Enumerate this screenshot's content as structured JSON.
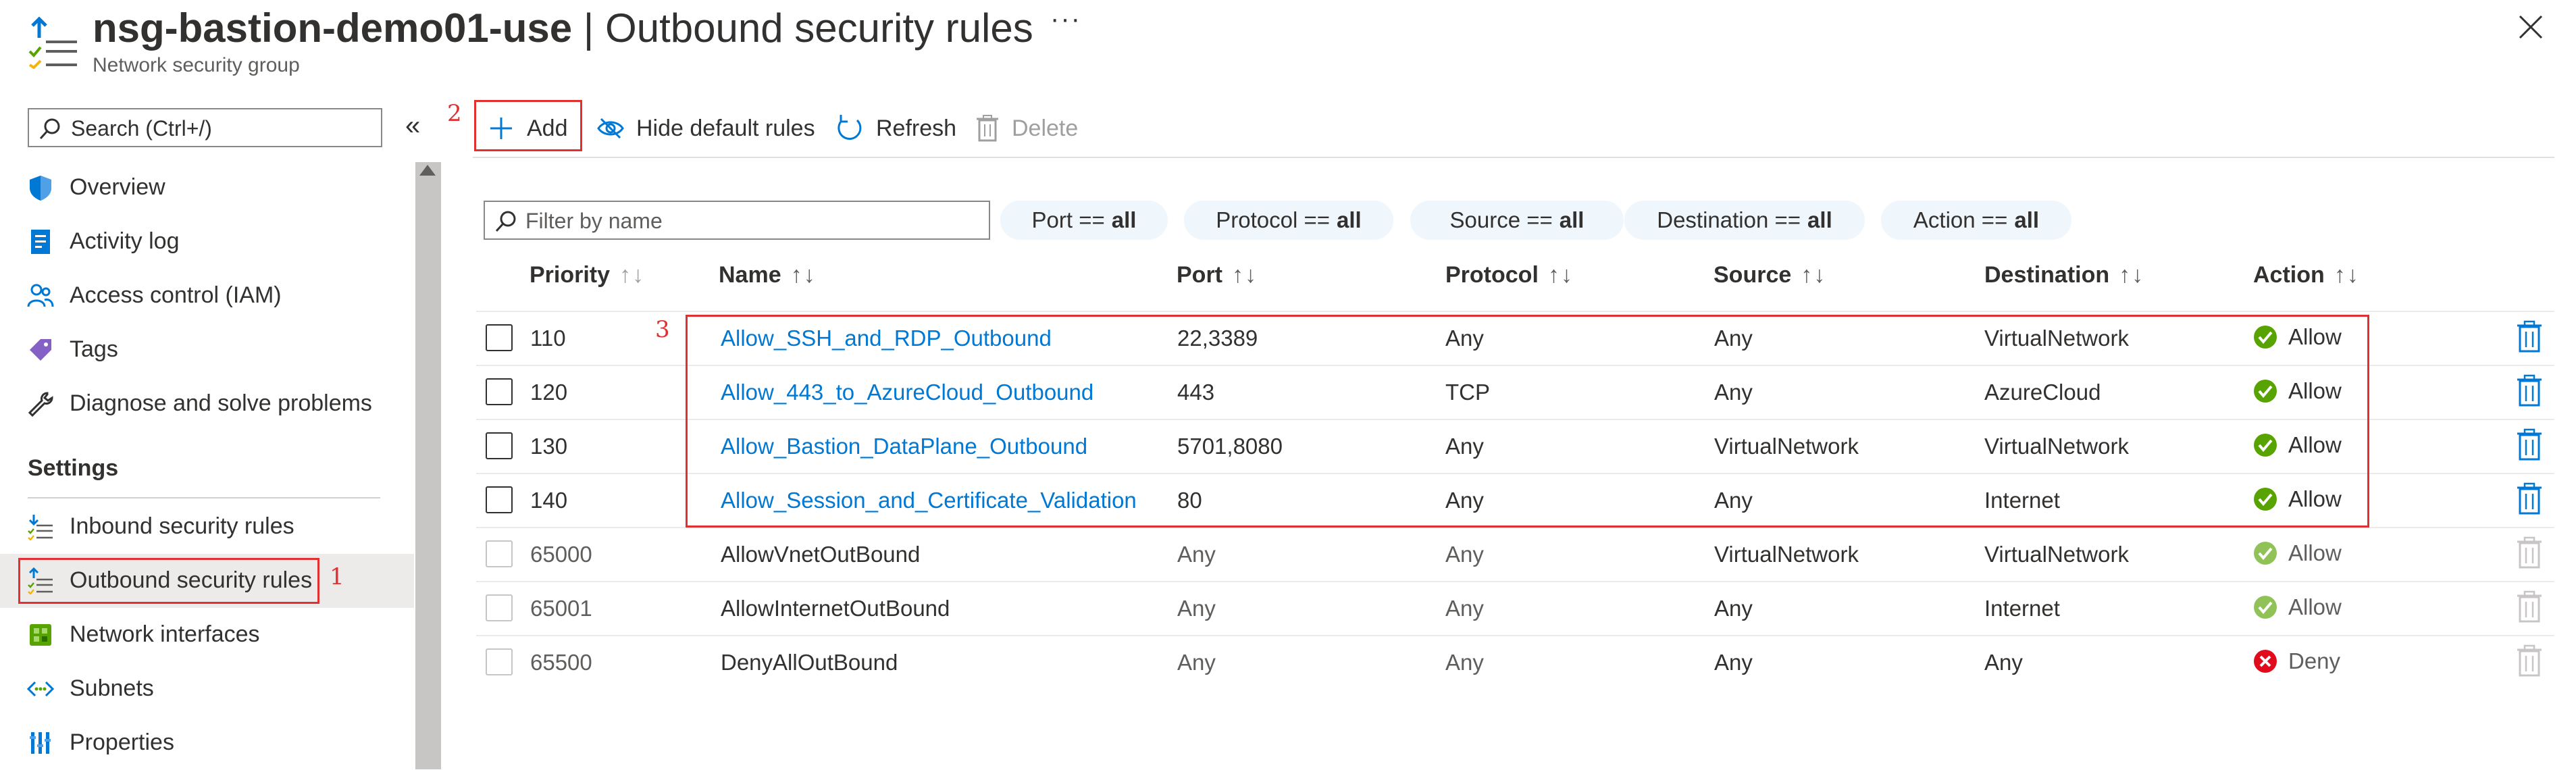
{
  "header": {
    "title_resource": "nsg-bastion-demo01-use",
    "title_separator": " | ",
    "title_page": "Outbound security rules",
    "subtitle": "Network security group",
    "more_label": "···"
  },
  "sidebar": {
    "search_placeholder": "Search (Ctrl+/)",
    "collapse_label": "«",
    "items": [
      {
        "label": "Overview",
        "icon": "shield-icon"
      },
      {
        "label": "Activity log",
        "icon": "activity-log-icon"
      },
      {
        "label": "Access control (IAM)",
        "icon": "people-icon"
      },
      {
        "label": "Tags",
        "icon": "tag-icon"
      },
      {
        "label": "Diagnose and solve problems",
        "icon": "wrench-icon"
      }
    ],
    "settings_header": "Settings",
    "settings_items": [
      {
        "label": "Inbound security rules",
        "icon": "inbound-rules-icon"
      },
      {
        "label": "Outbound security rules",
        "icon": "outbound-rules-icon",
        "selected": true
      },
      {
        "label": "Network interfaces",
        "icon": "network-interface-icon"
      },
      {
        "label": "Subnets",
        "icon": "subnet-icon"
      },
      {
        "label": "Properties",
        "icon": "properties-icon"
      }
    ]
  },
  "toolbar": {
    "add_label": "Add",
    "hide_default_label": "Hide default rules",
    "refresh_label": "Refresh",
    "delete_label": "Delete"
  },
  "filters": {
    "name_placeholder": "Filter by name",
    "pills": [
      {
        "key": "Port == ",
        "value": "all"
      },
      {
        "key": "Protocol == ",
        "value": "all"
      },
      {
        "key": "Source == ",
        "value": "all"
      },
      {
        "key": "Destination == ",
        "value": "all"
      },
      {
        "key": "Action == ",
        "value": "all"
      }
    ]
  },
  "table": {
    "columns": [
      "Priority",
      "Name",
      "Port",
      "Protocol",
      "Source",
      "Destination",
      "Action"
    ],
    "rows": [
      {
        "priority": "110",
        "name": "Allow_SSH_and_RDP_Outbound",
        "port": "22,3389",
        "protocol": "Any",
        "source": "Any",
        "destination": "VirtualNetwork",
        "action": "Allow",
        "custom": true
      },
      {
        "priority": "120",
        "name": "Allow_443_to_AzureCloud_Outbound",
        "port": "443",
        "protocol": "TCP",
        "source": "Any",
        "destination": "AzureCloud",
        "action": "Allow",
        "custom": true
      },
      {
        "priority": "130",
        "name": "Allow_Bastion_DataPlane_Outbound",
        "port": "5701,8080",
        "protocol": "Any",
        "source": "VirtualNetwork",
        "destination": "VirtualNetwork",
        "action": "Allow",
        "custom": true
      },
      {
        "priority": "140",
        "name": "Allow_Session_and_Certificate_Validation",
        "port": "80",
        "protocol": "Any",
        "source": "Any",
        "destination": "Internet",
        "action": "Allow",
        "custom": true
      },
      {
        "priority": "65000",
        "name": "AllowVnetOutBound",
        "port": "Any",
        "protocol": "Any",
        "source": "VirtualNetwork",
        "destination": "VirtualNetwork",
        "action": "Allow",
        "custom": false
      },
      {
        "priority": "65001",
        "name": "AllowInternetOutBound",
        "port": "Any",
        "protocol": "Any",
        "source": "Any",
        "destination": "Internet",
        "action": "Allow",
        "custom": false
      },
      {
        "priority": "65500",
        "name": "DenyAllOutBound",
        "port": "Any",
        "protocol": "Any",
        "source": "Any",
        "destination": "Any",
        "action": "Deny",
        "custom": false
      }
    ]
  },
  "callouts": {
    "one": "1",
    "two": "2",
    "three": "3"
  },
  "colors": {
    "accent": "#0078d4",
    "allow": "#57a300",
    "deny": "#e00b1c",
    "annotation": "#e03030"
  }
}
